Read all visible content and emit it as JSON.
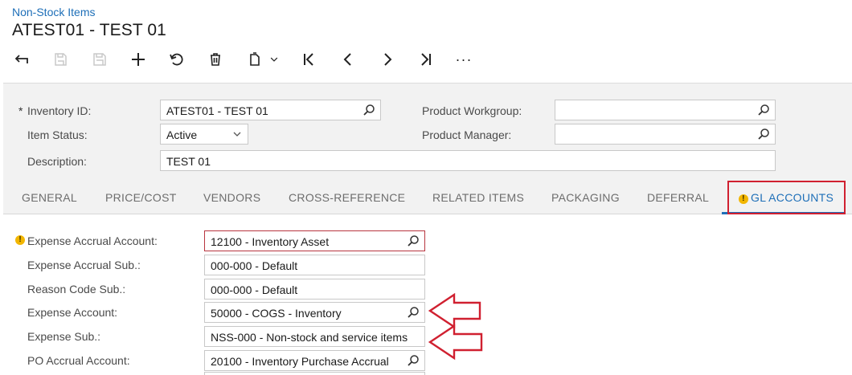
{
  "header": {
    "breadcrumb": "Non-Stock Items",
    "title": "ATEST01 - TEST 01"
  },
  "toolbar": {
    "icons": [
      "back-icon",
      "save-close-icon",
      "save-icon",
      "add-icon",
      "undo-icon",
      "delete-icon",
      "copy-paste-icon",
      "first-record-icon",
      "previous-record-icon",
      "next-record-icon",
      "last-record-icon",
      "more-icon"
    ],
    "more_label": "···"
  },
  "form": {
    "inventory_id": {
      "required_mark": "*",
      "label": "Inventory ID:",
      "value": "ATEST01 - TEST 01"
    },
    "item_status": {
      "label": "Item Status:",
      "value": "Active"
    },
    "description": {
      "label": "Description:",
      "value": "TEST 01"
    },
    "product_workgroup": {
      "label": "Product Workgroup:",
      "value": ""
    },
    "product_manager": {
      "label": "Product Manager:",
      "value": ""
    }
  },
  "tabs": [
    {
      "label": "GENERAL"
    },
    {
      "label": "PRICE/COST"
    },
    {
      "label": "VENDORS"
    },
    {
      "label": "CROSS-REFERENCE"
    },
    {
      "label": "RELATED ITEMS"
    },
    {
      "label": "PACKAGING"
    },
    {
      "label": "DEFERRAL"
    },
    {
      "label": "GL ACCOUNTS",
      "active": true,
      "warning": "!"
    }
  ],
  "gl_accounts": {
    "rows": [
      {
        "label": "Expense Accrual Account:",
        "value": "12100 - Inventory Asset",
        "warning": "!",
        "lookup": true
      },
      {
        "label": "Expense Accrual Sub.:",
        "value": "000-000 - Default",
        "lookup": false
      },
      {
        "label": "Reason Code Sub.:",
        "value": "000-000 - Default",
        "lookup": false
      },
      {
        "label": "Expense Account:",
        "value": "50000 - COGS - Inventory",
        "lookup": true
      },
      {
        "label": "Expense Sub.:",
        "value": "NSS-000 - Non-stock and service items",
        "lookup": false
      },
      {
        "label": "PO Accrual Account:",
        "value": "20100 - Inventory Purchase Accrual",
        "lookup": true
      }
    ]
  },
  "colors": {
    "accent": "#1e6fb8",
    "annotation_red": "#d02030",
    "warning_yellow": "#f2b600",
    "panel_bg": "#f2f2f2"
  }
}
